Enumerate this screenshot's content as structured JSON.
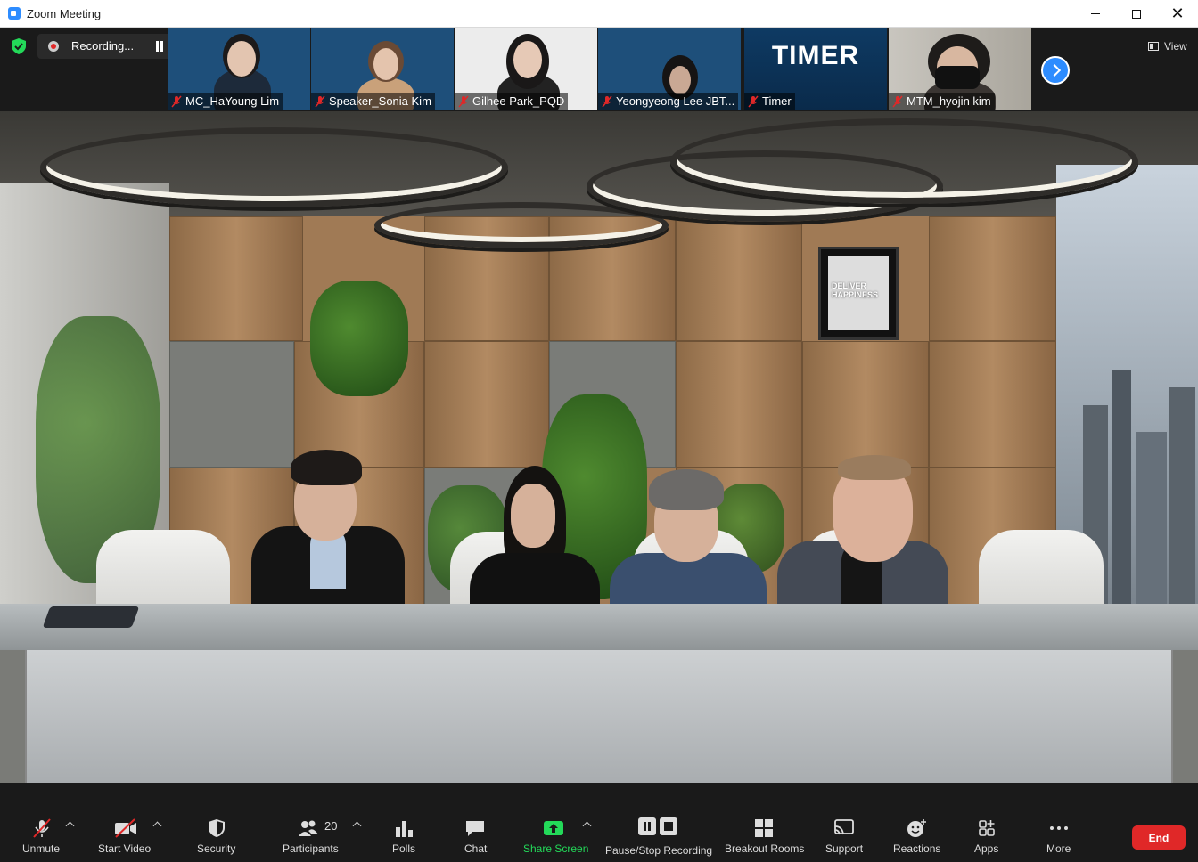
{
  "window": {
    "title": "Zoom Meeting"
  },
  "recording": {
    "status_text": "Recording..."
  },
  "participants_strip": [
    {
      "name": "MC_HaYoung Lim",
      "muted": true,
      "bg": "#1e4f7a"
    },
    {
      "name": "Speaker_Sonia Kim",
      "muted": true,
      "bg": "#1e4f7a"
    },
    {
      "name": "Gilhee Park_PQD",
      "muted": true,
      "bg": "#e9e9e9"
    },
    {
      "name": "Yeongyeong Lee JBT...",
      "muted": true,
      "bg": "#1e4f7a"
    },
    {
      "name": "Timer",
      "muted": true,
      "bg": "#10365c",
      "overlay_text": "TIMER"
    },
    {
      "name": "MTM_hyojin kim",
      "muted": true,
      "bg": "#b9b5ad"
    }
  ],
  "view_button": {
    "label": "View"
  },
  "main_video": {
    "poster_text": "DELIVER HAPPINESS"
  },
  "toolbar": {
    "unmute": "Unmute",
    "start_video": "Start Video",
    "security": "Security",
    "participants": "Participants",
    "participants_count": "20",
    "polls": "Polls",
    "chat": "Chat",
    "share_screen": "Share Screen",
    "pause_stop_recording": "Pause/Stop Recording",
    "breakout_rooms": "Breakout Rooms",
    "support": "Support",
    "reactions": "Reactions",
    "apps": "Apps",
    "more": "More",
    "end": "End"
  },
  "colors": {
    "accent_blue": "#2d8cff",
    "share_green": "#23d959",
    "end_red": "#e02828",
    "muted_red": "#e02828"
  }
}
